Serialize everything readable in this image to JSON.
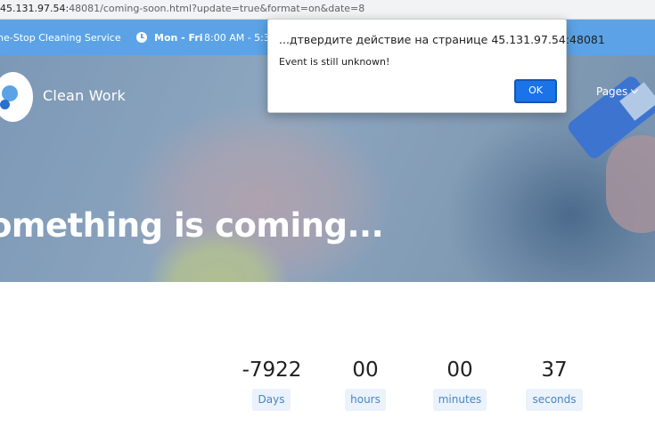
{
  "browser": {
    "url_host": "45.131.97.54:",
    "url_rest": "48081/coming-soon.html?update=true&format=on&date=8"
  },
  "topbar": {
    "tagline": "ne-Stop Cleaning Service",
    "days": "Mon - Fri",
    "hours": "8:00 AM - 5:30"
  },
  "header": {
    "brand": "Clean Work",
    "nav_pages": "Pages"
  },
  "hero": {
    "headline": "omething is coming..."
  },
  "countdown": [
    {
      "value": "-7922",
      "unit": "Days"
    },
    {
      "value": "00",
      "unit": "hours"
    },
    {
      "value": "00",
      "unit": "minutes"
    },
    {
      "value": "37",
      "unit": "seconds"
    }
  ],
  "dialog": {
    "title": "...дтвердите действие на странице 45.131.97.54:48081",
    "message": "Event is still unknown!",
    "ok_label": "OK"
  },
  "colors": {
    "topbar": "#5ba3e6",
    "accent": "#1a73e8",
    "unit_bg": "#eaf2fb"
  }
}
